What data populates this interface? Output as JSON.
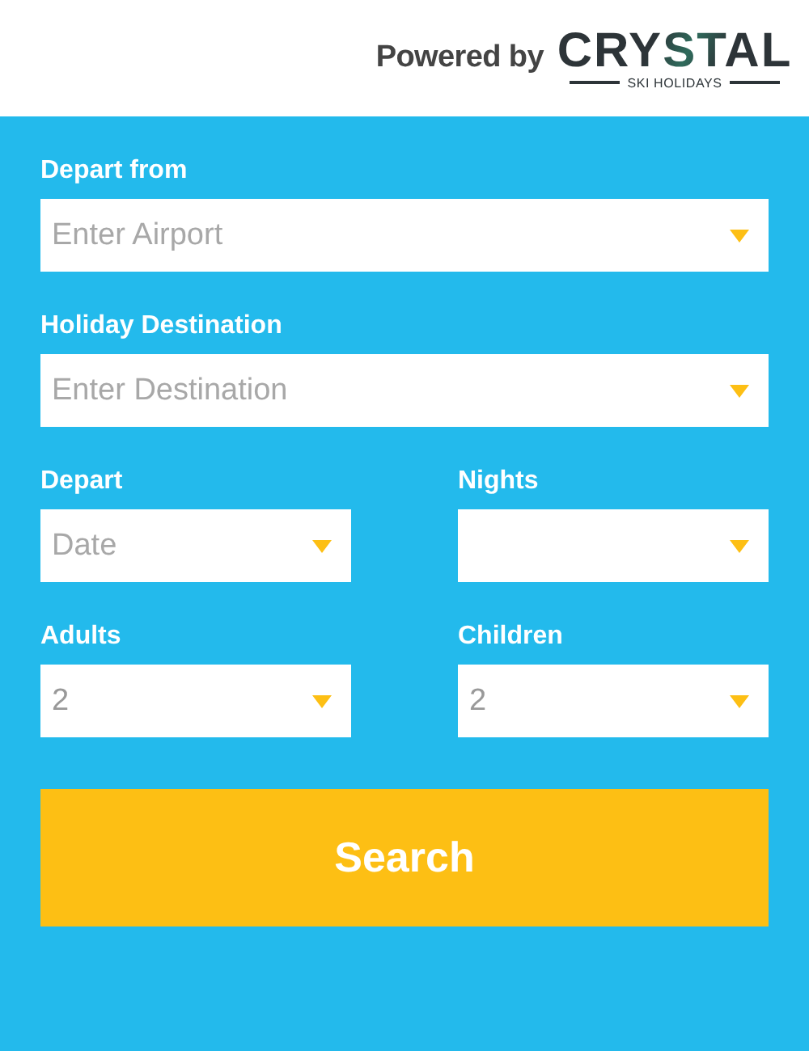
{
  "header": {
    "powered_by": "Powered by",
    "logo": {
      "wordmark": "CRYSTAL",
      "tagline": "SKI HOLIDAYS"
    }
  },
  "form": {
    "rows": [
      [
        {
          "label": "Depart from",
          "placeholder": "Enter Airport"
        }
      ],
      [
        {
          "label": "Holiday Destination",
          "placeholder": "Enter Destination"
        }
      ],
      [
        {
          "label": "Depart",
          "placeholder": "Date"
        },
        {
          "label": "Nights"
        }
      ],
      [
        {
          "label": "Adults",
          "value": "2"
        },
        {
          "label": "Children",
          "value": "2"
        }
      ]
    ],
    "submit": "Search"
  }
}
